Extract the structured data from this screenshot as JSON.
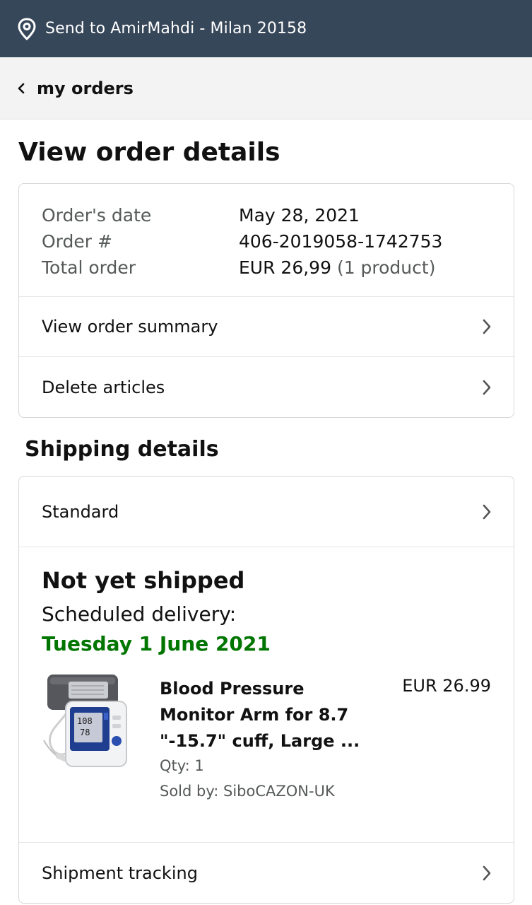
{
  "header": {
    "address": "Send to AmirMahdi - Milan 20158",
    "location_icon": "location-pin-icon"
  },
  "nav": {
    "back_label": "my orders",
    "back_icon": "chevron-left-icon"
  },
  "page_title": "View order details",
  "order": {
    "date_label": "Order's date",
    "date_value": "May 28, 2021",
    "number_label": "Order #",
    "number_value": "406-2019058-1742753",
    "total_label": "Total order",
    "total_value": "EUR 26,99",
    "total_count": "(1 product)",
    "summary_link": "View order summary",
    "delete_link": "Delete articles"
  },
  "shipping": {
    "section_title": "Shipping details",
    "method": "Standard",
    "status": "Not yet shipped",
    "scheduled_label": "Scheduled delivery:",
    "delivery_date": "Tuesday 1 June 2021",
    "delivery_color": "#007600",
    "tracking_link": "Shipment tracking"
  },
  "product": {
    "name": "Blood Pressure Monitor Arm for 8.7 \"-15.7\" cuff, Large ...",
    "price": "EUR 26.99",
    "qty": "Qty: 1",
    "seller": "Sold by: SiboCAZON-UK",
    "image_icon": "blood-pressure-monitor-image"
  },
  "colors": {
    "header_bg": "#37475a",
    "nav_bg": "#f3f3f3",
    "muted_text": "#565959"
  }
}
